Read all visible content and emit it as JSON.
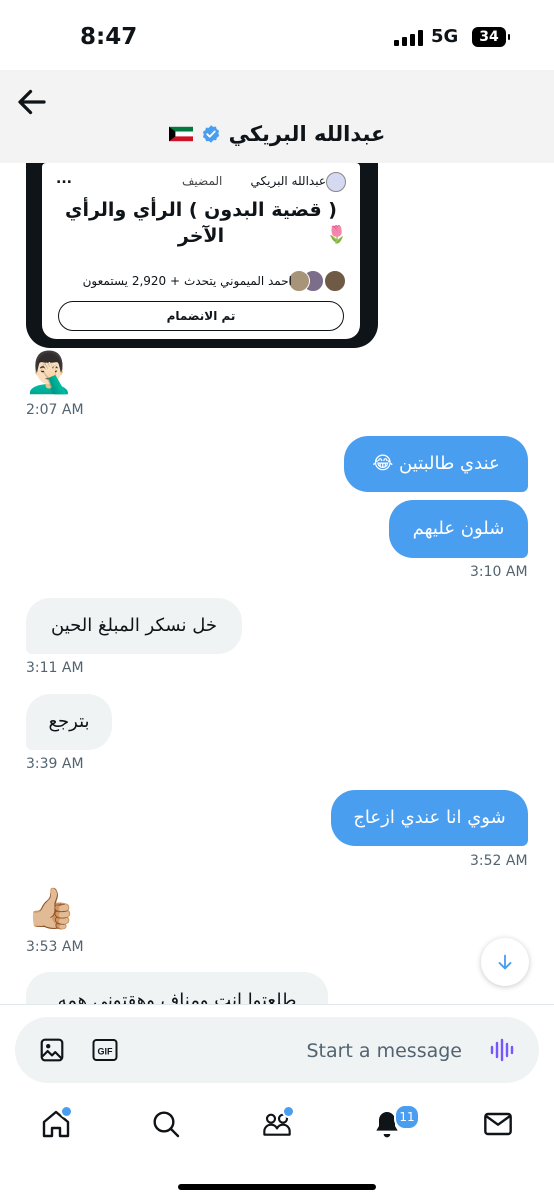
{
  "status": {
    "time": "8:47",
    "network": "5G",
    "battery": "34"
  },
  "header": {
    "title": "عبدالله البريكي",
    "verified": true,
    "flag": "kuwait-flag"
  },
  "card": {
    "host_name": "عبدالله البريكي",
    "host_role": "المضيف",
    "more": "...",
    "title": "( قضية البدون ) الرأي والرأي الآخر",
    "title_emoji": "🌷",
    "speaking": "احمد الميموني يتحدث",
    "listeners": "+ 2,920 يستمعون",
    "join_label": "تم الانضمام"
  },
  "messages": [
    {
      "id": "m0",
      "direction": "in",
      "emoji": "🤦🏻‍♂️",
      "time": "2:07 AM"
    },
    {
      "id": "m1",
      "direction": "out",
      "text": "عندي طالبتين 😂"
    },
    {
      "id": "m2",
      "direction": "out",
      "text": "شلون عليهم",
      "time": "3:10 AM"
    },
    {
      "id": "m3",
      "direction": "in",
      "text": "خل نسكر المبلغ الحين",
      "time": "3:11 AM"
    },
    {
      "id": "m4",
      "direction": "in",
      "text": "بترجع",
      "time": "3:39 AM"
    },
    {
      "id": "m5",
      "direction": "out",
      "text": "شوي انا عندي ازعاج",
      "time": "3:52 AM"
    },
    {
      "id": "m6",
      "direction": "in",
      "emoji": "👍🏼",
      "time": "3:53 AM"
    },
    {
      "id": "m7",
      "direction": "in",
      "text": "طلعتوا انت ومناف وهقتوني همه"
    }
  ],
  "composer": {
    "placeholder": "Start a message"
  },
  "tabs": [
    {
      "name": "home",
      "dot": true
    },
    {
      "name": "search",
      "dot": false
    },
    {
      "name": "communities",
      "dot": true
    },
    {
      "name": "notifications",
      "badge": "11"
    },
    {
      "name": "messages",
      "dot": false
    }
  ],
  "colors": {
    "accent": "#4a9ef0",
    "incoming_bubble": "#eff3f4",
    "header_bg": "#f3f3f4"
  }
}
